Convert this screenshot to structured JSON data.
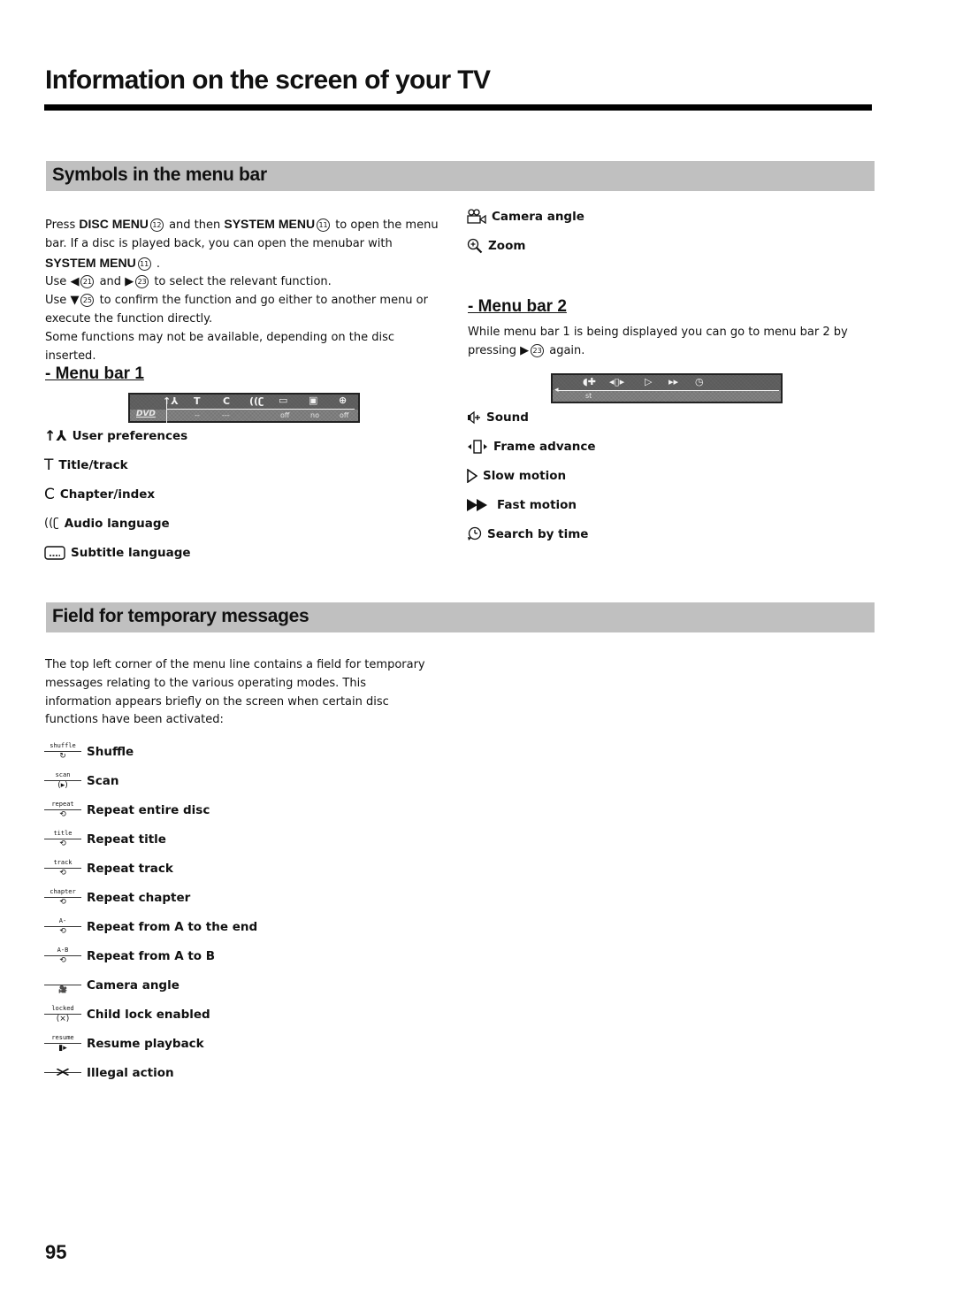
{
  "page": {
    "title": "Information on the screen of your TV",
    "page_number": "95"
  },
  "section_symbols": {
    "heading": "Symbols in the menu bar",
    "intro": {
      "press": "Press",
      "disc_menu": "DISC MENU",
      "disc_menu_num": "12",
      "and_then": "and then",
      "system_menu": "SYSTEM MENU",
      "system_menu_num": "11",
      "to_open": "to open the menu bar. If a disc is played back, you can open the menubar with",
      "system_menu_2": "SYSTEM MENU",
      "system_menu_2_num": "11",
      "period": ".",
      "use1": "Use",
      "left_arrow": "◀",
      "left_num": "21",
      "and": "and",
      "right_arrow": "▶",
      "right_num": "23",
      "use1_rest": "to select the relevant function.",
      "use2": "Use",
      "down_arrow": "▼",
      "down_num": "25",
      "use2_rest": "to confirm the function and go either to another menu or execute the function directly.",
      "note": "Some functions may not be available, depending on the disc inserted."
    },
    "menu_bar_1": {
      "heading": "- Menu bar 1",
      "osd": {
        "logo": "DVD",
        "icons": [
          "user-preferences",
          "title-track",
          "chapter-index",
          "audio-language",
          "subtitle-language",
          "camera-angle",
          "zoom"
        ],
        "values": [
          "--",
          "---",
          "",
          "off",
          "no",
          "off"
        ]
      },
      "items": [
        {
          "icon": "user-preferences-icon",
          "label": "User preferences"
        },
        {
          "icon": "title-track-icon",
          "label": "Title/track"
        },
        {
          "icon": "chapter-index-icon",
          "label": "Chapter/index"
        },
        {
          "icon": "audio-language-icon",
          "label": "Audio language"
        },
        {
          "icon": "subtitle-language-icon",
          "label": "Subtitle language"
        }
      ],
      "items_right": [
        {
          "icon": "camera-angle-icon",
          "label": "Camera angle"
        },
        {
          "icon": "zoom-icon",
          "label": "Zoom"
        }
      ]
    },
    "menu_bar_2": {
      "heading": "- Menu bar 2",
      "text_a": "While menu bar 1 is being displayed you can go to menu bar 2 by pressing",
      "arrow": "▶",
      "num": "23",
      "text_b": "again.",
      "osd": {
        "icons": [
          "sound",
          "frame-advance",
          "slow-motion",
          "fast-motion",
          "search-by-time"
        ],
        "value": "st"
      },
      "items": [
        {
          "icon": "sound-icon",
          "label": "Sound"
        },
        {
          "icon": "frame-advance-icon",
          "label": "Frame advance"
        },
        {
          "icon": "slow-motion-icon",
          "label": "Slow motion"
        },
        {
          "icon": "fast-motion-icon",
          "label": "Fast motion"
        },
        {
          "icon": "search-by-time-icon",
          "label": "Search by time"
        }
      ]
    }
  },
  "section_messages": {
    "heading": "Field for temporary messages",
    "text": "The top left corner of the menu line contains a field for temporary messages relating to the various operating modes. This information appears briefly on the screen when certain disc functions have been activated:",
    "items": [
      {
        "tag": "shuffle",
        "glyph": "↻",
        "label": "Shuffle"
      },
      {
        "tag": "scan",
        "glyph": "(▸)",
        "label": "Scan"
      },
      {
        "tag": "repeat",
        "glyph": "⟲",
        "label": "Repeat entire disc"
      },
      {
        "tag": "title",
        "glyph": "⟲",
        "label": "Repeat title"
      },
      {
        "tag": "track",
        "glyph": "⟲",
        "label": "Repeat track"
      },
      {
        "tag": "chapter",
        "glyph": "⟲",
        "label": "Repeat chapter"
      },
      {
        "tag": "A-",
        "glyph": "⟲",
        "label": "Repeat from A to the end"
      },
      {
        "tag": "A-B",
        "glyph": "⟲",
        "label": "Repeat from A to B"
      },
      {
        "tag": "",
        "glyph": "🎥",
        "label": "Camera angle"
      },
      {
        "tag": "locked",
        "glyph": "(⨯)",
        "label": "Child lock enabled"
      },
      {
        "tag": "resume",
        "glyph": "▮▸",
        "label": "Resume playback"
      },
      {
        "tag": "",
        "glyph": "✕",
        "label": "Illegal action"
      }
    ]
  }
}
